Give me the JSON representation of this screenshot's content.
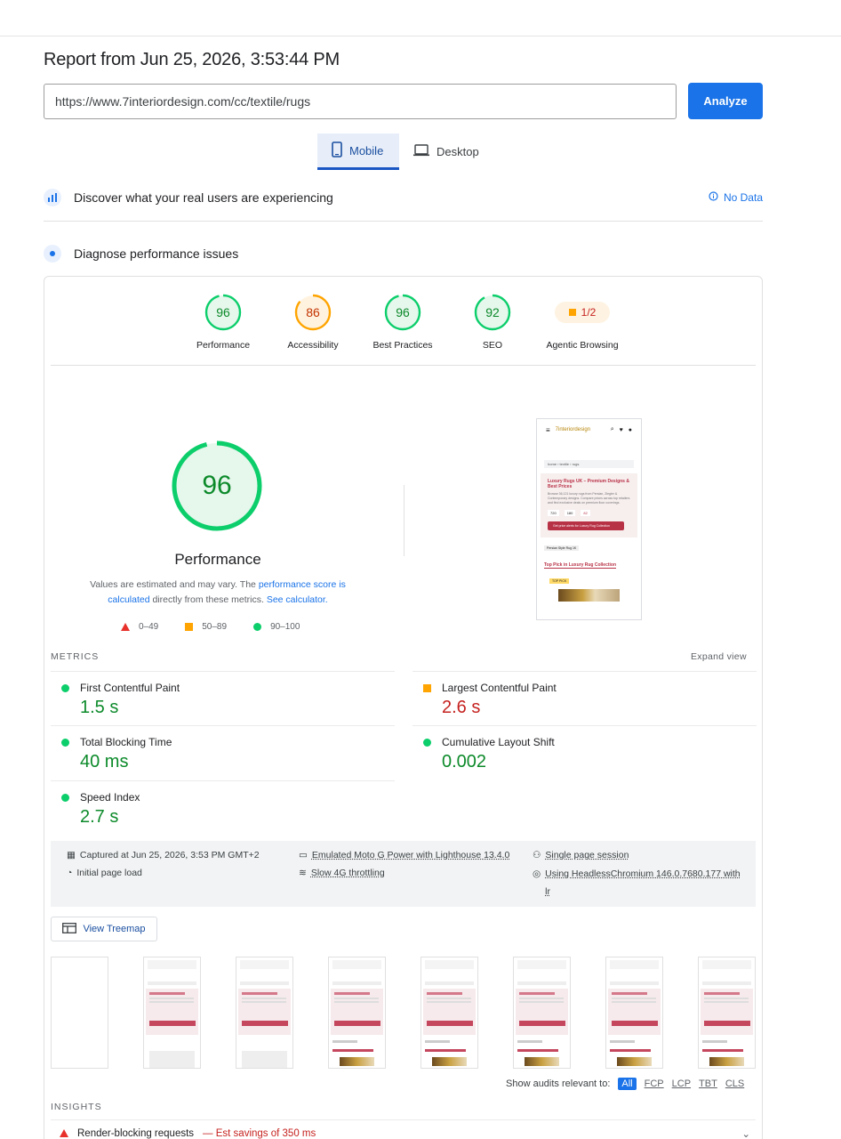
{
  "header": {
    "title": "Report from Jun 25, 2026, 3:53:44 PM",
    "url_value": "https://www.7interiordesign.com/cc/textile/rugs",
    "analyze_label": "Analyze"
  },
  "tabs": [
    {
      "label": "Mobile",
      "active": true
    },
    {
      "label": "Desktop",
      "active": false
    }
  ],
  "sections": {
    "real_users": "Discover what your real users are experiencing",
    "no_data": "No Data",
    "diagnose": "Diagnose performance issues"
  },
  "scores": [
    {
      "value": "96",
      "score": 96,
      "label": "Performance",
      "color": "#0cce6b",
      "text_color": "#0c8a2a",
      "bg": "#e6f7ec"
    },
    {
      "value": "86",
      "score": 86,
      "label": "Accessibility",
      "color": "#ffa400",
      "text_color": "#c33300",
      "bg": "#fff3e0"
    },
    {
      "value": "96",
      "score": 96,
      "label": "Best Practices",
      "color": "#0cce6b",
      "text_color": "#0c8a2a",
      "bg": "#e6f7ec"
    },
    {
      "value": "92",
      "score": 92,
      "label": "SEO",
      "color": "#0cce6b",
      "text_color": "#0c8a2a",
      "bg": "#e6f7ec"
    }
  ],
  "agentic": {
    "value": "1/2",
    "label": "Agentic Browsing"
  },
  "performance": {
    "score": "96",
    "score_value": 96,
    "title": "Performance",
    "desc_1": "Values are estimated and may vary. The ",
    "desc_link1": "performance score is calculated",
    "desc_2": " directly from these metrics. ",
    "desc_link2": "See calculator.",
    "legend": [
      "0–49",
      "50–89",
      "90–100"
    ]
  },
  "phone_preview": {
    "brand": "7interiordesign",
    "breadcrumb": "home › textile › rugs",
    "hero_title": "Luxury Rugs UK – Premium Designs & Best Prices",
    "hero_text": "Browse 36,121 luxury rugs from Persian, Ziegler & Contemporary designs. Compare prices across top retailers and find exclusive deals on premium floor coverings.",
    "stats": [
      "720",
      "180",
      "82"
    ],
    "cta": "Get price alerts for Luxury Rug Collection",
    "tag": "Persian Style Rug 1K",
    "section_title": "Top Pick in Luxury Rug Collection",
    "badge": "TOP PICK"
  },
  "metrics": {
    "header": "METRICS",
    "expand": "Expand view",
    "items": [
      {
        "name": "First Contentful Paint",
        "value": "1.5 s",
        "status": "good"
      },
      {
        "name": "Largest Contentful Paint",
        "value": "2.6 s",
        "status": "average"
      },
      {
        "name": "Total Blocking Time",
        "value": "40 ms",
        "status": "good"
      },
      {
        "name": "Cumulative Layout Shift",
        "value": "0.002",
        "status": "good"
      },
      {
        "name": "Speed Index",
        "value": "2.7 s",
        "status": "good"
      }
    ]
  },
  "environment": {
    "captured": "Captured at Jun 25, 2026, 3:53 PM GMT+2",
    "load": "Initial page load",
    "device": "Emulated Moto G Power with Lighthouse 13.4.0",
    "throttle": "Slow 4G throttling",
    "session": "Single page session",
    "browser": "Using HeadlessChromium 146.0.7680.177 with lr"
  },
  "treemap_label": "View Treemap",
  "audits_filter": {
    "label": "Show audits relevant to:",
    "options": [
      "All",
      "FCP",
      "LCP",
      "TBT",
      "CLS"
    ]
  },
  "insights": {
    "header": "INSIGHTS",
    "first": "Render-blocking requests",
    "first_savings": "— Est savings of 350 ms"
  },
  "colors": {
    "accent": "#1a73e8",
    "good": "#0cce6b",
    "average": "#ffa400",
    "poor": "#ff4e42"
  }
}
